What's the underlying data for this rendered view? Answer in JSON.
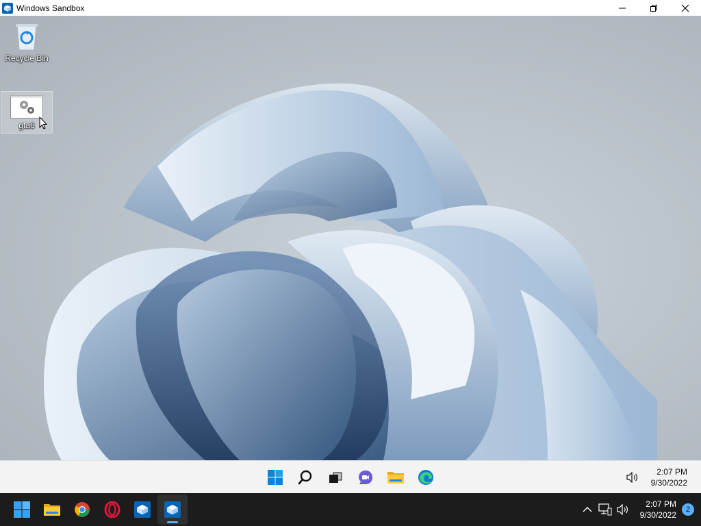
{
  "window": {
    "title": "Windows Sandbox",
    "controls": [
      "minimize-icon",
      "restore-icon",
      "close-icon"
    ]
  },
  "desktop": {
    "icons": [
      {
        "label": "Recycle Bin",
        "icon": "recycle-bin-icon"
      },
      {
        "label": "gta6",
        "icon": "settings-file-icon",
        "selected": true
      }
    ]
  },
  "inner_taskbar": {
    "apps": [
      "windows-start-icon",
      "search-icon",
      "task-view-icon",
      "chat-icon",
      "file-explorer-icon",
      "edge-icon"
    ],
    "tray": {
      "volume_icon": "volume-icon",
      "time": "2:07 PM",
      "date": "9/30/2022"
    }
  },
  "host_taskbar": {
    "apps": [
      "windows-start-icon",
      "file-explorer-icon",
      "chrome-icon",
      "opera-icon",
      "sandbox-icon",
      "sandbox-active-icon"
    ],
    "tray": {
      "icons": [
        "chevron-up-icon",
        "network-icon",
        "volume-icon"
      ],
      "time": "2:07 PM",
      "date": "9/30/2022",
      "notifications": "2"
    }
  },
  "colors": {
    "accent": "#0078d4",
    "host_taskbar": "#1c1c1c",
    "inner_taskbar": "#f3f3f3"
  }
}
